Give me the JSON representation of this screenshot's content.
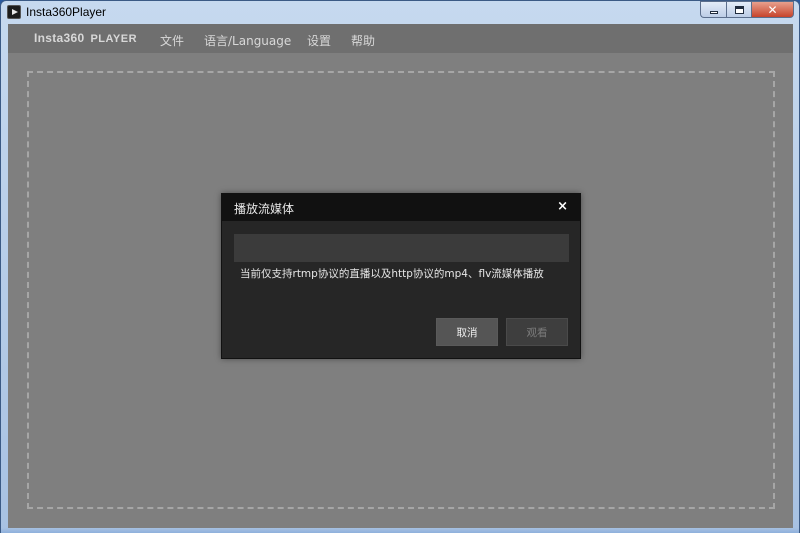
{
  "window": {
    "title": "Insta360Player",
    "controls": {
      "minimize": "",
      "maximize": "",
      "close": "✕"
    }
  },
  "menubar": {
    "brand": "Insta360",
    "brand_suffix": "PLAYER",
    "items": [
      {
        "label": "文件"
      },
      {
        "label": "语言/Language"
      },
      {
        "label": "设置"
      },
      {
        "label": "帮助"
      }
    ]
  },
  "dialog": {
    "title": "播放流媒体",
    "close": "×",
    "input_value": "",
    "input_placeholder": "",
    "hint": "当前仅支持rtmp协议的直播以及http协议的mp4、flv流媒体播放",
    "cancel_label": "取消",
    "watch_label": "观看"
  },
  "colors": {
    "menubar_bg": "#6f6f6f",
    "client_bg": "#7f7f7f",
    "dialog_bg": "#262626",
    "dialog_header_bg": "#111111"
  }
}
